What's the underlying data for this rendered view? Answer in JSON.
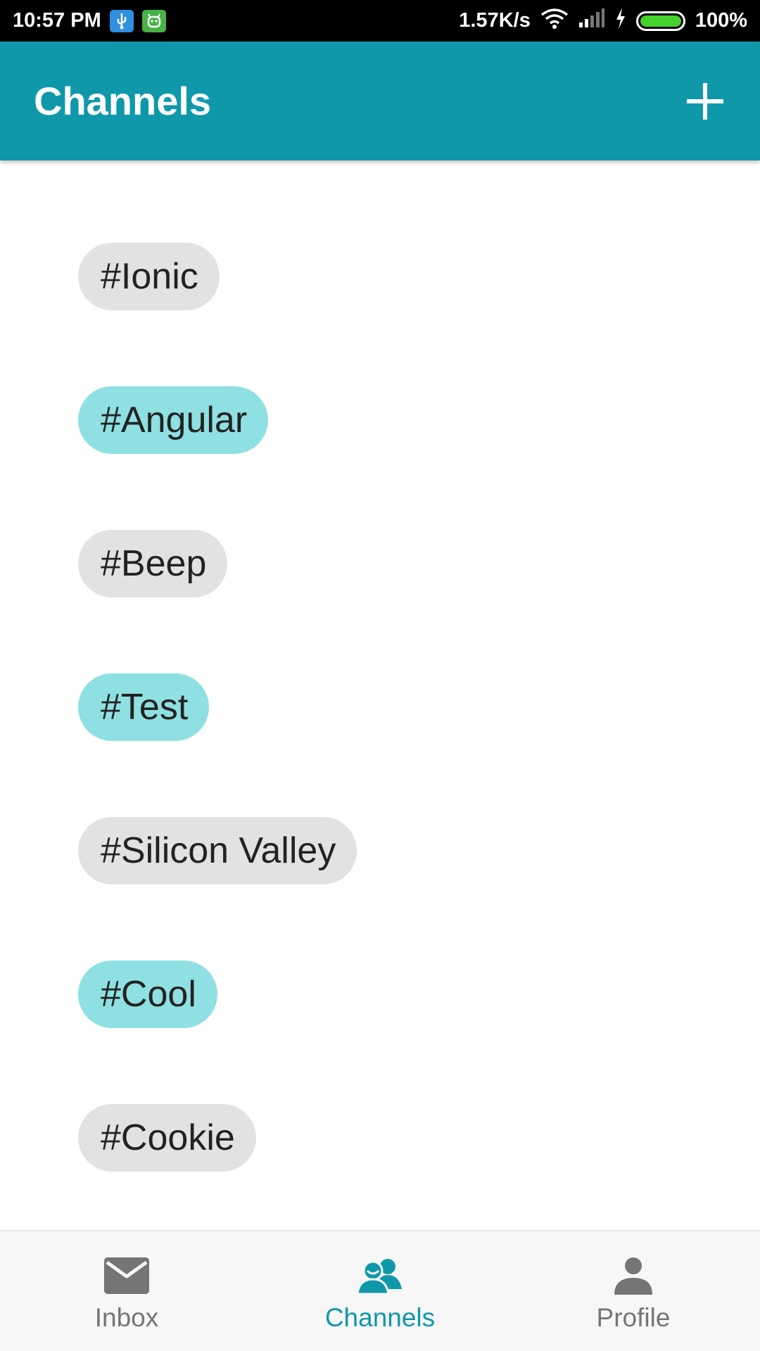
{
  "status_bar": {
    "time": "10:57 PM",
    "network_speed": "1.57K/s",
    "battery_percent": "100%",
    "icons": [
      "usb-icon",
      "android-debug-icon",
      "wifi-icon",
      "signal-icon",
      "charging-icon",
      "battery-icon"
    ]
  },
  "app_bar": {
    "title": "Channels",
    "add_icon": "plus-icon"
  },
  "channels": [
    {
      "label": "#Ionic",
      "color": "#e2e2e2"
    },
    {
      "label": "#Angular",
      "color": "#8fe0e2"
    },
    {
      "label": "#Beep",
      "color": "#e2e2e2"
    },
    {
      "label": "#Test",
      "color": "#8fe0e2"
    },
    {
      "label": "#Silicon Valley",
      "color": "#e2e2e2"
    },
    {
      "label": "#Cool",
      "color": "#8fe0e2"
    },
    {
      "label": "#Cookie",
      "color": "#e2e2e2"
    }
  ],
  "tabs": [
    {
      "label": "Inbox",
      "icon": "envelope-icon",
      "active": false
    },
    {
      "label": "Channels",
      "icon": "people-icon",
      "active": true
    },
    {
      "label": "Profile",
      "icon": "person-icon",
      "active": false
    }
  ],
  "colors": {
    "primary": "#0f98aa",
    "chip_grey": "#e2e2e2",
    "chip_teal": "#8fe0e2",
    "inactive_tab": "#757575"
  }
}
